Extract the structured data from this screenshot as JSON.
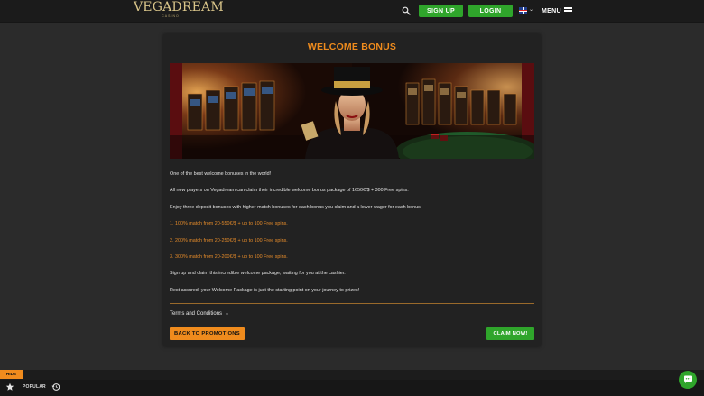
{
  "header": {
    "logo_main": "VEGADREAM",
    "logo_sub": "CASINO",
    "signup_label": "SIGN UP",
    "login_label": "LOGIN",
    "menu_label": "MENU",
    "language_icon": "uk-flag-icon"
  },
  "promo": {
    "title": "WELCOME BONUS",
    "paragraphs": [
      "One of the best welcome bonuses in the world!",
      "All new players on Vegadream can claim their incredible welcome bonus package of 1650€/$ + 300 Free spins.",
      "Enjoy three deposit bonuses with higher match bonuses for each bonus you claim and a lower wager for each bonus.",
      "1. 100% match from 20-550€/$ +  up to 100 Free spins.",
      "2. 200% match from 20-250€/$ +  up to 100 Free spins.",
      "3. 300% match from 20-200€/$ +  up to 100 Free spins.",
      "Sign up and claim this incredible welcome package, waiting for you at the cashier.",
      "Rest assured, your Welcome Package is just the starting point on your journey to prizes!"
    ],
    "terms_label": "Terms and Conditions",
    "back_label": "BACK TO PROMOTIONS",
    "claim_label": "CLAIM NOW!"
  },
  "footer": {
    "hide_label": "HIDE",
    "popular_label": "POPULAR"
  },
  "colors": {
    "accent_orange": "#ee8b1d",
    "accent_green": "#2fa52b",
    "background": "#2b2b2b",
    "card": "#222222"
  }
}
